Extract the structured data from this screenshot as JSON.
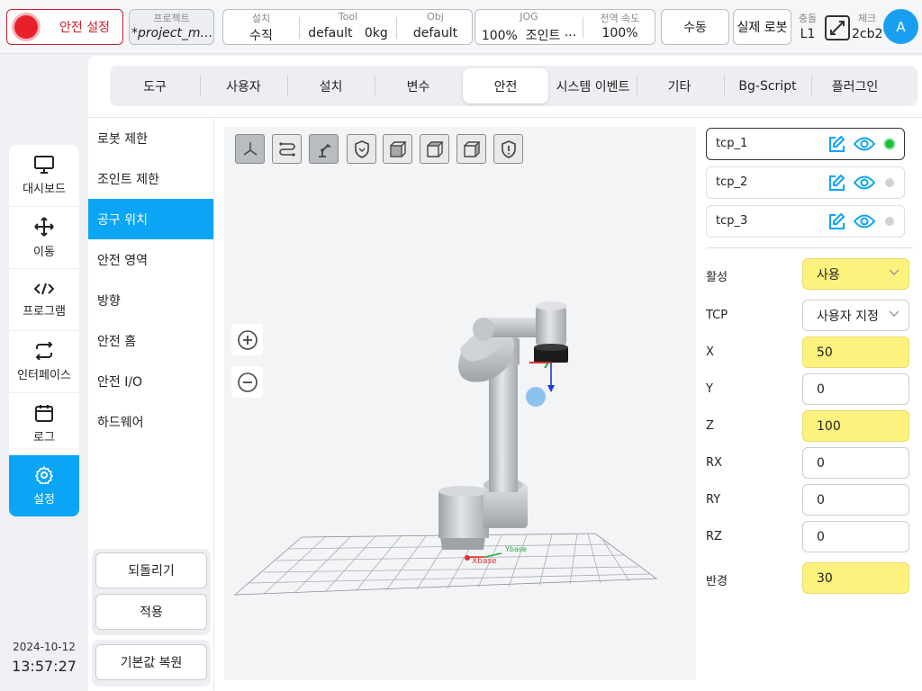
{
  "topbar": {
    "safety_label": "안전 설정",
    "project": {
      "caption": "프로젝트",
      "value": "*project_mo···"
    },
    "install": {
      "caption": "설치",
      "value": "수직"
    },
    "tool": {
      "caption": "Tool",
      "value": "default   0kg"
    },
    "obj": {
      "caption": "Obj",
      "value": "default"
    },
    "jog": {
      "caption": "JOG",
      "value": "100%  조인트 ···"
    },
    "global_speed": {
      "caption": "전역 속도",
      "value": "100%"
    },
    "manual_label": "수동",
    "real_robot_label": "실제 로봇",
    "collision": {
      "caption": "충돌",
      "value": "L1"
    },
    "check": {
      "caption": "체크",
      "value": "2cb2"
    },
    "avatar_letter": "A"
  },
  "nav": {
    "items": [
      {
        "label": "대시보드",
        "icon": "monitor-icon"
      },
      {
        "label": "이동",
        "icon": "move-arrows-icon"
      },
      {
        "label": "프로그램",
        "icon": "code-icon"
      },
      {
        "label": "인터페이스",
        "icon": "swap-arrows-icon"
      },
      {
        "label": "로그",
        "icon": "calendar-icon"
      },
      {
        "label": "설정",
        "icon": "gear-icon"
      }
    ],
    "active": "설정",
    "date": "2024-10-12",
    "time": "13:57:27"
  },
  "tabs": [
    "도구",
    "사용자",
    "설치",
    "변수",
    "안전",
    "시스템 이벤트",
    "기타",
    "Bg-Script",
    "플러그인"
  ],
  "active_tab": "안전",
  "subnav": {
    "items": [
      "로봇 제한",
      "조인트 제한",
      "공구 위치",
      "안전 영역",
      "방향",
      "안전 홈",
      "안전 I/O",
      "하드웨어"
    ],
    "active": "공구 위치",
    "revert_label": "되돌리기",
    "apply_label": "적용",
    "restore_label": "기본값 복원"
  },
  "viewport": {
    "toolbar_icons": [
      "axes-icon",
      "path-icon",
      "robot-arm-icon",
      "shield-icon",
      "cube-view-front-icon",
      "cube-view-top-icon",
      "cube-view-side-icon",
      "shield-alert-icon"
    ],
    "axis_labels": {
      "x": "Xbase",
      "y": "Ybase"
    }
  },
  "tcp_list": [
    {
      "name": "tcp_1",
      "selected": true,
      "active": true
    },
    {
      "name": "tcp_2",
      "selected": false,
      "active": false
    },
    {
      "name": "tcp_3",
      "selected": false,
      "active": false
    }
  ],
  "fields": {
    "enable": {
      "label": "활성",
      "value": "사용"
    },
    "tcp": {
      "label": "TCP",
      "value": "사용자 지정"
    },
    "x": {
      "label": "X",
      "value": "50"
    },
    "y": {
      "label": "Y",
      "value": "0"
    },
    "z": {
      "label": "Z",
      "value": "100"
    },
    "rx": {
      "label": "RX",
      "value": "0"
    },
    "ry": {
      "label": "RY",
      "value": "0"
    },
    "rz": {
      "label": "RZ",
      "value": "0"
    },
    "radius": {
      "label": "반경",
      "value": "30"
    }
  },
  "colors": {
    "accent": "#0aa5f5",
    "safety_red": "#e8202a",
    "highlight_yellow": "#fdf27e",
    "active_green": "#19c23a"
  }
}
